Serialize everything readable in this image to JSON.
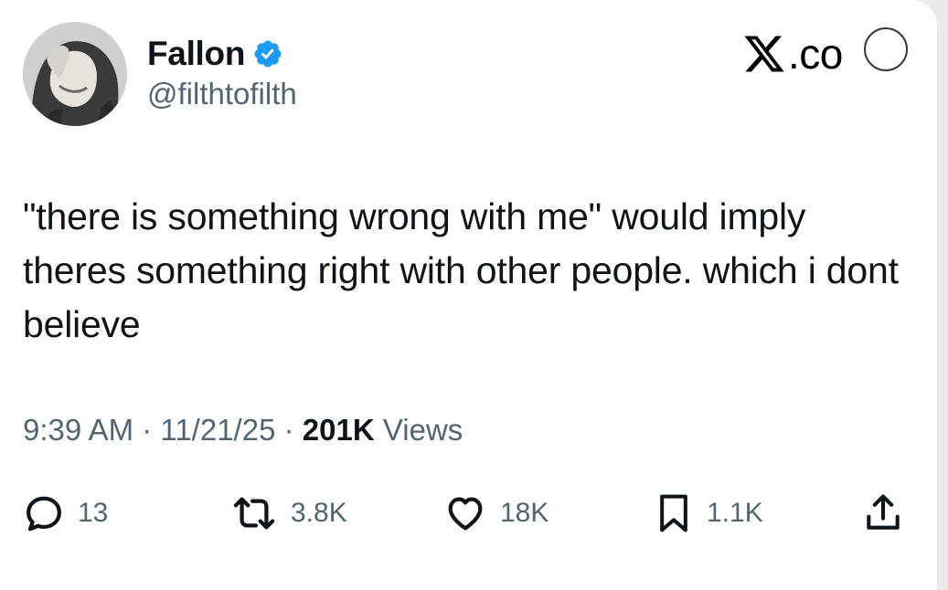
{
  "author": {
    "name": "Fallon",
    "handle": "@filthtofilth",
    "verified": true,
    "badge_color": "#1d9bf0"
  },
  "brand": {
    "text": ".co"
  },
  "tweet": {
    "text": "\"there is something wrong with me\" would imply theres something right with other people. which i dont believe"
  },
  "meta": {
    "time": "9:39 AM",
    "separator": "·",
    "date": "11/21/25",
    "views_count": "201K",
    "views_label": "Views"
  },
  "actions": {
    "replies": "13",
    "reposts": "3.8K",
    "likes": "18K",
    "bookmarks": "1.1K",
    "icons": [
      "reply-icon",
      "repost-icon",
      "like-icon",
      "bookmark-icon",
      "share-icon"
    ]
  },
  "colors": {
    "text_primary": "#0f1419",
    "text_secondary": "#536471",
    "background": "#ffffff"
  }
}
